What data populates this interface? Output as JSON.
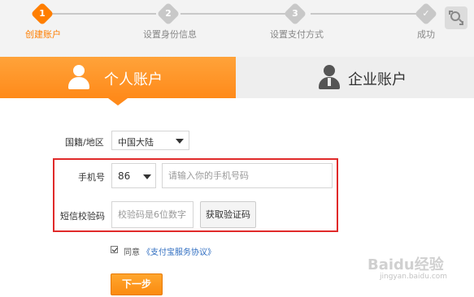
{
  "stepper": {
    "steps": [
      {
        "number": "1",
        "label": "创建账户",
        "state": "active"
      },
      {
        "number": "2",
        "label": "设置身份信息",
        "state": "pending"
      },
      {
        "number": "3",
        "label": "设置支付方式",
        "state": "pending"
      },
      {
        "number": "✓",
        "label": "成功",
        "state": "pending"
      }
    ],
    "active_color": "#ff7e00",
    "pending_color": "#c8c8c8"
  },
  "corner_icon": "fullscreen-search-icon",
  "tabs": {
    "personal": {
      "label": "个人账户",
      "icon": "person-icon",
      "selected": true
    },
    "enterprise": {
      "label": "企业账户",
      "icon": "businessman-icon",
      "selected": false
    }
  },
  "form": {
    "region": {
      "label": "国籍/地区",
      "value": "中国大陆"
    },
    "phone": {
      "label": "手机号",
      "country_code": "86",
      "placeholder": "请输入你的手机号码"
    },
    "sms": {
      "label": "短信校验码",
      "placeholder": "校验码是6位数字",
      "button_label": "获取验证码"
    },
    "agreement": {
      "checked": true,
      "prefix": "同意",
      "link_text": "《支付宝服务协议》"
    },
    "next_label": "下一步"
  },
  "colors": {
    "accent": "#ff8a1a",
    "highlight_frame": "#e02a2a",
    "link": "#2d6cc0"
  },
  "watermark": {
    "text": "Baidu经验",
    "sub": "jingyan.baidu.com"
  }
}
